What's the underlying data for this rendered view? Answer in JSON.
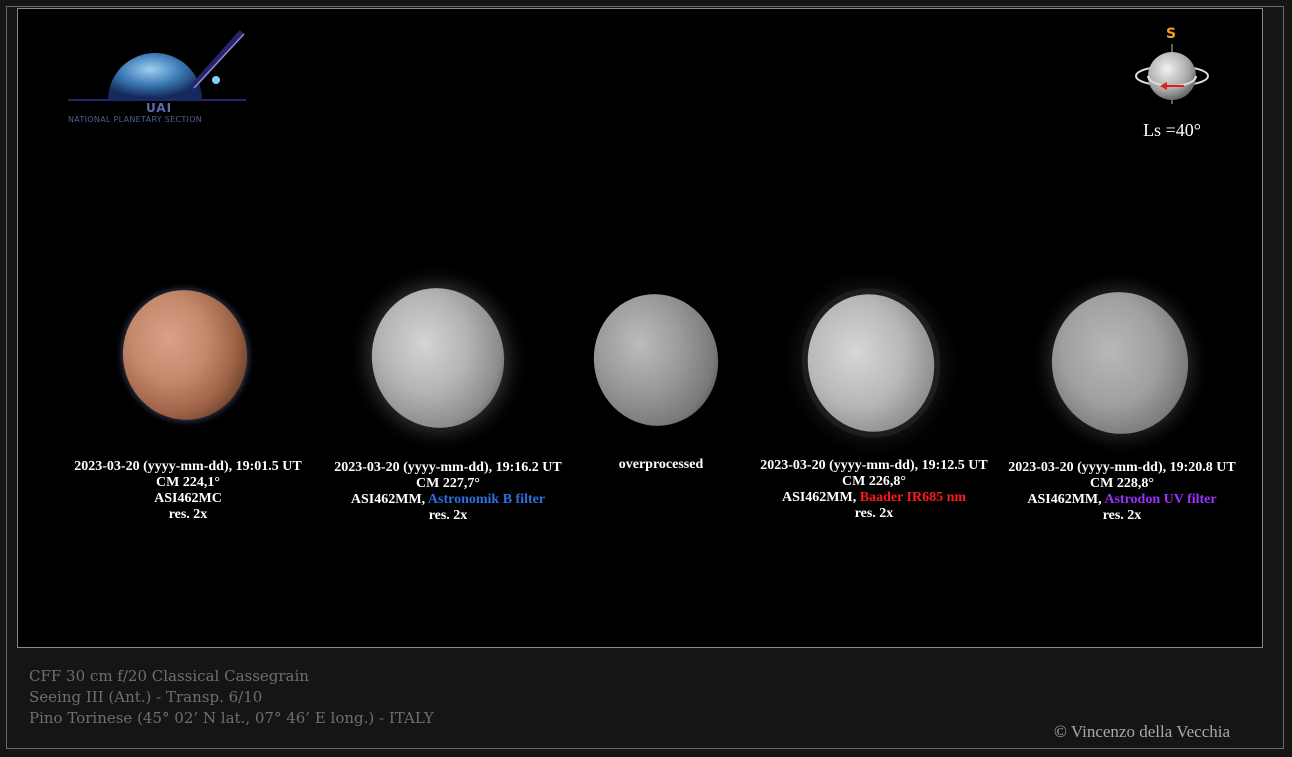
{
  "logo": {
    "name": "UAI",
    "subtitle": "NATIONAL PLANETARY SECTION"
  },
  "orientation": {
    "pole_label": "S",
    "ls_label": "Ls =40°"
  },
  "images": [
    {
      "line1": "2023-03-20 (yyyy-mm-dd), 19:01.5 UT",
      "line2": "CM 224,1°",
      "camera": "ASI462MC",
      "filter": "",
      "res": "res. 2x"
    },
    {
      "line1": "2023-03-20  (yyyy-mm-dd), 19:16.2 UT",
      "line2": "CM 227,7°",
      "camera": "ASI462MM, ",
      "filter": "Astronomik B filter",
      "res": "res. 2x"
    },
    {
      "line1": "overprocessed"
    },
    {
      "line1": "2023-03-20  (yyyy-mm-dd), 19:12.5 UT",
      "line2": "CM 226,8°",
      "camera": "ASI462MM, ",
      "filter": "Baader IR685 nm",
      "res": "res. 2x"
    },
    {
      "line1": "2023-03-20  (yyyy-mm-dd), 19:20.8 UT",
      "line2": "CM 228,8°",
      "camera": "ASI462MM, ",
      "filter": "Astrodon UV filter",
      "res": "res. 2x"
    }
  ],
  "footer": {
    "telescope": "CFF 30 cm f/20 Classical Cassegrain",
    "conditions": "Seeing  III (Ant.) - Transp. 6/10",
    "location": "Pino Torinese (45° 02’ N lat., 07° 46’ E long.) - ITALY",
    "copyright": "© Vincenzo della Vecchia"
  },
  "colors": {
    "background": "#151515",
    "panel": "#000000",
    "filter_blue": "#2f6fe0",
    "filter_red": "#ff1a1a",
    "filter_purple": "#9b30ff",
    "pole_marker": "#f0a020",
    "direction_arrow": "#e02020"
  }
}
